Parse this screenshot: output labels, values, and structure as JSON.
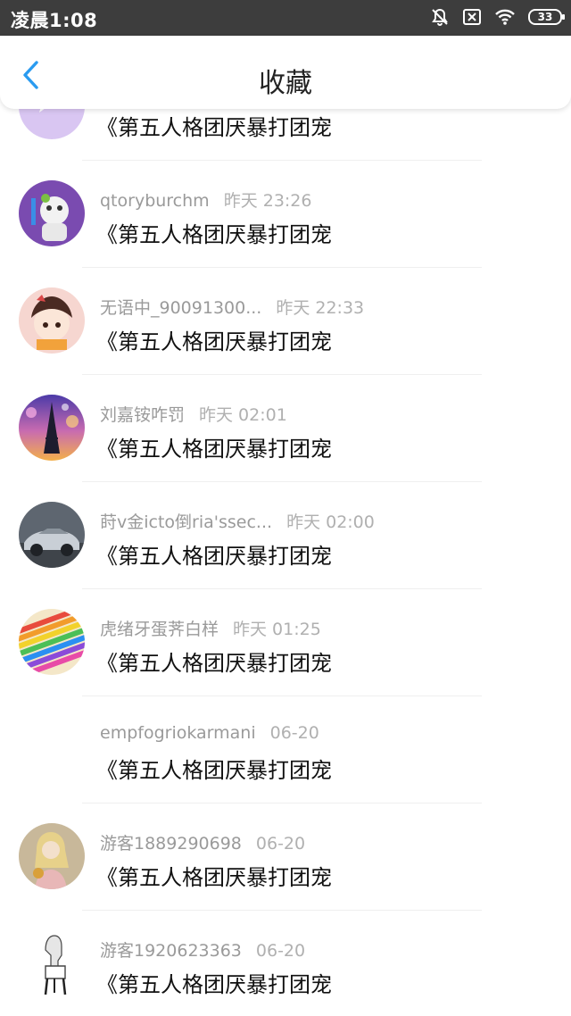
{
  "status_bar": {
    "time": "凌晨1:08",
    "battery": "33"
  },
  "header": {
    "title": "收藏"
  },
  "items": [
    {
      "user": "",
      "time": "",
      "title": "《第五人格团厌暴打团宠"
    },
    {
      "user": "qtoryburchm",
      "time": "昨天 23:26",
      "title": "《第五人格团厌暴打团宠"
    },
    {
      "user": "无语中_90091300...",
      "time": "昨天 22:33",
      "title": "《第五人格团厌暴打团宠"
    },
    {
      "user": "刘嘉铵咋罚",
      "time": "昨天 02:01",
      "title": "《第五人格团厌暴打团宠"
    },
    {
      "user": "莳v金icto倒ria'ssec...",
      "time": "昨天 02:00",
      "title": "《第五人格团厌暴打团宠"
    },
    {
      "user": "虎绪牙蛋荠白样",
      "time": "昨天 01:25",
      "title": "《第五人格团厌暴打团宠"
    },
    {
      "user": "empfogriokarmani",
      "time": "06-20",
      "title": "《第五人格团厌暴打团宠"
    },
    {
      "user": "游客1889290698",
      "time": "06-20",
      "title": "《第五人格团厌暴打团宠"
    },
    {
      "user": "游客1920623363",
      "time": "06-20",
      "title": "《第五人格团厌暴打团宠"
    }
  ],
  "colors": {
    "accent": "#2a9bf0",
    "status_bar": "#3d3d3d"
  }
}
